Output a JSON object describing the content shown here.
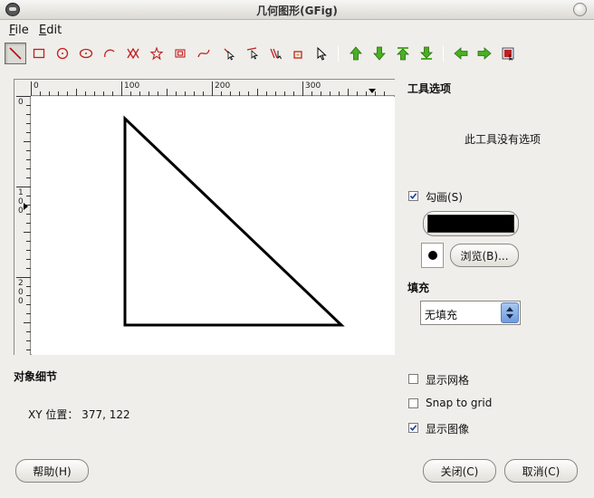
{
  "window": {
    "title": "几何图形(GFig)"
  },
  "menu": {
    "file_label": "File",
    "file_accel": "F",
    "file_rest": "ile",
    "edit_label": "Edit",
    "edit_accel": "E",
    "edit_rest": "dit"
  },
  "toolbar": {
    "tools": [
      "line-tool",
      "rectangle-tool",
      "circle-tool",
      "ellipse-tool",
      "arc-tool",
      "polygon-tool",
      "star-tool",
      "spiral-tool",
      "bezier-tool",
      "move-object-tool",
      "move-point-tool",
      "copy-object-tool",
      "delete-object-tool",
      "select-object-tool",
      "raise-object",
      "lower-object",
      "raise-to-top",
      "lower-to-bottom",
      "show-previous",
      "show-next",
      "show-all"
    ],
    "active_tool": "line-tool"
  },
  "ruler": {
    "h_labels": [
      "0",
      "100",
      "200",
      "300"
    ],
    "v_labels": [
      [
        "0"
      ],
      [
        "1",
        "0",
        "0"
      ],
      [
        "2",
        "0",
        "0"
      ]
    ]
  },
  "tool_options": {
    "title": "工具选项",
    "message": "此工具没有选项"
  },
  "stroke": {
    "label": "勾画(S)",
    "checked": true,
    "color": "#000000",
    "browse_label": "浏览(B)..."
  },
  "fill": {
    "title": "填充",
    "selected": "无填充"
  },
  "object_details": {
    "title": "对象细节",
    "xy_text": "XY 位置： 377, 122"
  },
  "display": {
    "show_grid_label": "显示网格",
    "show_grid_checked": false,
    "snap_label": "Snap to grid",
    "snap_checked": false,
    "show_image_label": "显示图像",
    "show_image_checked": true
  },
  "buttons": {
    "help": "帮助(H)",
    "close": "关闭(C)",
    "cancel": "取消(C)"
  },
  "colors": {
    "accent_green": "#3c9a1e",
    "toolbar_red": "#c02020"
  }
}
